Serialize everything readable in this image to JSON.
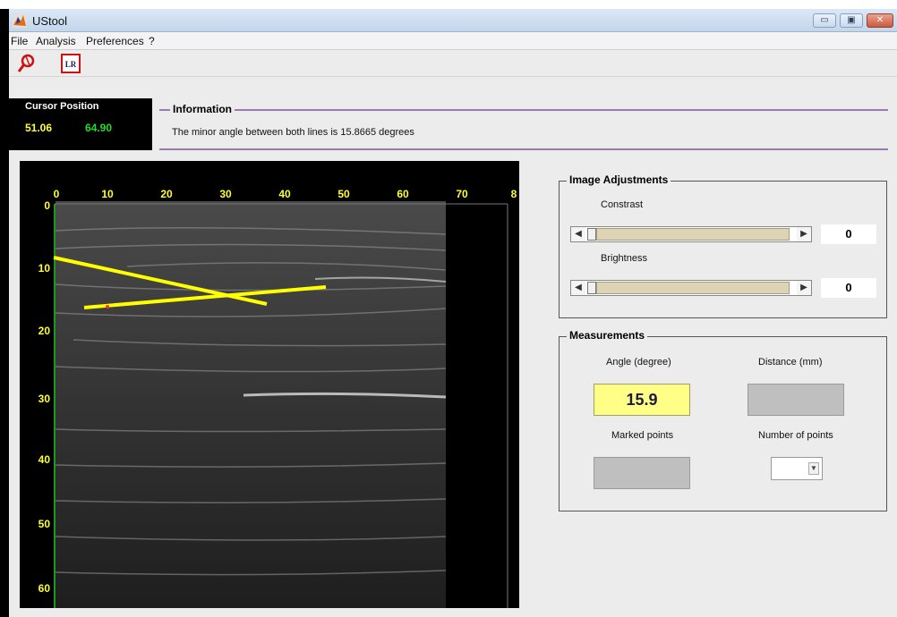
{
  "window": {
    "title": "UStool",
    "min_glyph": "▭",
    "max_glyph": "▣",
    "close_glyph": "✕"
  },
  "menu": {
    "items": [
      "File",
      "Analysis",
      "Preferences",
      "?"
    ]
  },
  "toolbar": {
    "icons": [
      "magnifier-icon",
      "lr-icon"
    ],
    "lr_label": "LR"
  },
  "cursor": {
    "title": "Cursor Position",
    "x": "51.06",
    "y": "64.90"
  },
  "information": {
    "title": "Information",
    "text": "The minor angle between both lines is 15.8665 degrees"
  },
  "image": {
    "x_ticks": [
      "0",
      "10",
      "20",
      "30",
      "40",
      "50",
      "60",
      "70",
      "8"
    ],
    "y_ticks": [
      "0",
      "10",
      "20",
      "30",
      "40",
      "50",
      "60"
    ],
    "line_color": "#ffff00"
  },
  "adjustments": {
    "title": "Image Adjustments",
    "contrast_label": "Constrast",
    "contrast_value": "0",
    "brightness_label": "Brightness",
    "brightness_value": "0"
  },
  "measurements": {
    "title": "Measurements",
    "angle_label": "Angle (degree)",
    "angle_value": "15.9",
    "distance_label": "Distance (mm)",
    "marked_label": "Marked points",
    "number_label": "Number of points"
  }
}
